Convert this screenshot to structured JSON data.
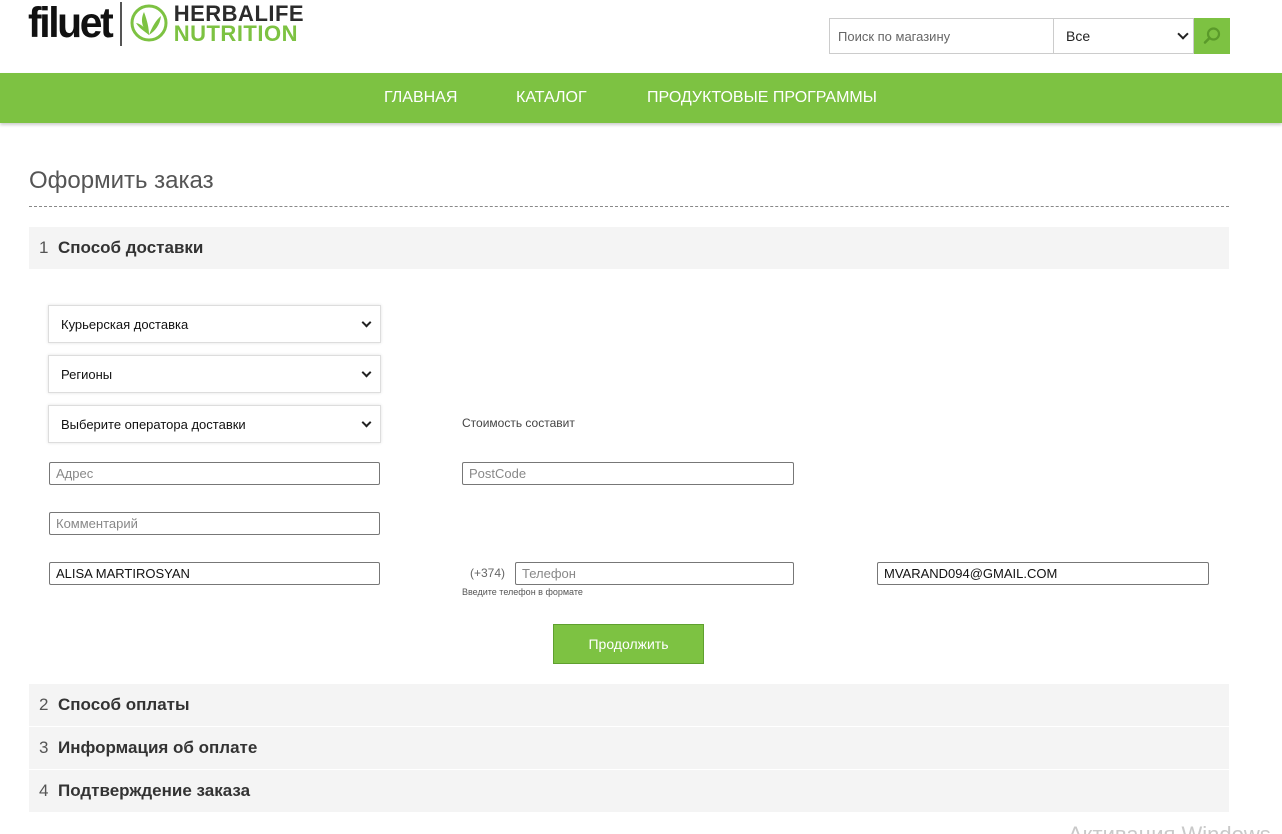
{
  "header": {
    "logo_filuet": "filuet",
    "logo_brand_line1": "HERBALIFE",
    "logo_brand_line2": "NUTRITION",
    "search": {
      "placeholder": "Поиск по магазину",
      "category_selected": "Все"
    }
  },
  "nav": {
    "items": [
      {
        "label": "ГЛАВНАЯ"
      },
      {
        "label": "КАТАЛОГ"
      },
      {
        "label": "ПРОДУКТОВЫЕ ПРОГРАММЫ"
      }
    ]
  },
  "checkout": {
    "title": "Оформить заказ",
    "steps": [
      {
        "num": "1",
        "label": "Способ доставки"
      },
      {
        "num": "2",
        "label": "Способ оплаты"
      },
      {
        "num": "3",
        "label": "Информация об оплате"
      },
      {
        "num": "4",
        "label": "Подтверждение заказа"
      }
    ],
    "delivery": {
      "method_selected": "Курьерская доставка",
      "region_selected": "Регионы",
      "operator_selected": "Выберите оператора доставки",
      "cost_label": "Стоимость составит",
      "address_placeholder": "Адрес",
      "postcode_placeholder": "PostCode",
      "comment_placeholder": "Комментарий",
      "name_value": "ALISA MARTIROSYAN",
      "phone_code": "(+374)",
      "phone_placeholder": "Телефон",
      "phone_hint": "Введите телефон в формате",
      "email_value": "MVARAND094@GMAIL.COM",
      "continue_label": "Продолжить"
    }
  },
  "watermark": "Активация Windows",
  "colors": {
    "brand_green": "#7dc242",
    "step_bg": "#f4f4f4"
  }
}
